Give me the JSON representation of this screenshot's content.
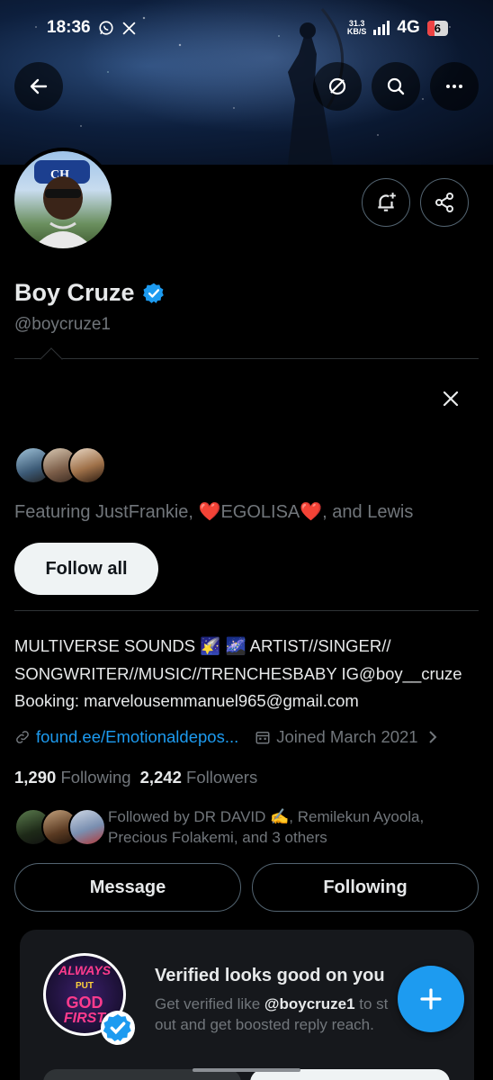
{
  "status_bar": {
    "time": "18:36",
    "net_speed_value": "31.3",
    "net_speed_unit": "KB/S",
    "network": "4G",
    "battery": "6"
  },
  "profile": {
    "name": "Boy Cruze",
    "handle": "@boycruze1",
    "verified": true
  },
  "suggestions": {
    "featuring_prefix": "Featuring JustFrankie, ",
    "heart": "❤️",
    "featuring_mid": "EGOLISA",
    "featuring_suffix": ", and Lewis",
    "follow_all_label": "Follow all"
  },
  "bio": {
    "line1": "MULTIVERSE SOUNDS 🌠 🌌 ARTIST//SINGER//",
    "line2": "SONGWRITER//MUSIC//TRENCHESBABY IG@boy__cruze",
    "line3": "Booking: marvelousemmanuel965@gmail.com"
  },
  "meta": {
    "link": "found.ee/Emotionaldepos...",
    "joined": "Joined March 2021"
  },
  "counts": {
    "following_count": "1,290",
    "following_label": "Following",
    "followers_count": "2,242",
    "followers_label": "Followers"
  },
  "followed_by": {
    "text": "Followed by DR DAVID ✍️, Remilekun Ayoola, Precious Folakemi, and 3 others"
  },
  "actions": {
    "message_label": "Message",
    "following_label": "Following"
  },
  "verified_card": {
    "title": "Verified looks good on you",
    "sub_prefix": "Get verified like ",
    "sub_handle": "@boycruze1",
    "sub_suffix": " to st",
    "sub_line2": "out and get boosted reply reach.",
    "logo_line1": "ALWAYS",
    "logo_line2": "PUT",
    "logo_line3": "GOD",
    "logo_line4": "FIRST"
  },
  "colors": {
    "accent": "#1d9bf0",
    "background": "#000000",
    "muted": "#71767b",
    "heart": "#e0245e"
  }
}
